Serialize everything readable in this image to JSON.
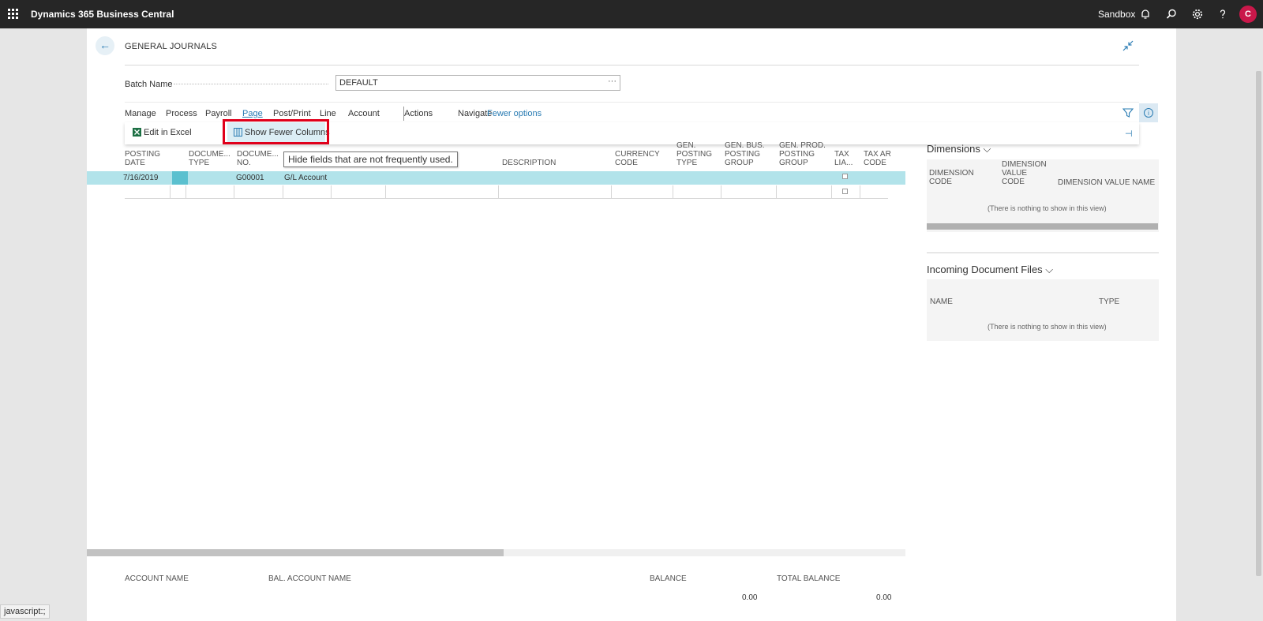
{
  "topbar": {
    "app_title": "Dynamics 365 Business Central",
    "environment": "Sandbox",
    "avatar_initial": "C"
  },
  "page": {
    "title": "GENERAL JOURNALS",
    "back_glyph": "←"
  },
  "batch": {
    "label": "Batch Name",
    "value": "DEFAULT",
    "lookup": "···"
  },
  "actions": {
    "items": [
      "Manage",
      "Process",
      "Payroll",
      "Page",
      "Post/Print",
      "Line",
      "Account",
      "Actions",
      "Navigate",
      "Fewer options"
    ],
    "active": "Page"
  },
  "subactions": {
    "edit_excel": "Edit in Excel",
    "show_fewer": "Show Fewer Columns"
  },
  "tooltip": "Hide fields that are not frequently used.",
  "grid": {
    "columns": [
      [
        "POSTING",
        "DATE"
      ],
      [
        "DOCUME...",
        "TYPE"
      ],
      [
        "DOCUME...",
        "NO."
      ],
      [
        "DESCRIPTION"
      ],
      [
        "CURRENCY",
        "CODE"
      ],
      [
        "GEN.",
        "POSTING",
        "TYPE"
      ],
      [
        "GEN. BUS.",
        "POSTING",
        "GROUP"
      ],
      [
        "GEN. PROD.",
        "POSTING",
        "GROUP"
      ],
      [
        "TAX",
        "LIA..."
      ],
      [
        "TAX AR",
        "CODE"
      ]
    ],
    "row": {
      "posting_date": "7/16/2019",
      "document_no": "G00001",
      "account_type": "G/L Account"
    }
  },
  "footer": {
    "account_name": "ACCOUNT NAME",
    "bal_account_name": "BAL. ACCOUNT NAME",
    "balance": "BALANCE",
    "total_balance": "TOTAL BALANCE",
    "balance_value": "0.00",
    "total_balance_value": "0.00"
  },
  "factbox": {
    "dimensions": {
      "title": "Dimensions",
      "col1": [
        "DIMENSION",
        "CODE"
      ],
      "col2": [
        "DIMENSION",
        "VALUE",
        "CODE"
      ],
      "col3": "DIMENSION VALUE NAME",
      "empty": "(There is nothing to show in this view)"
    },
    "incoming": {
      "title": "Incoming Document Files",
      "col1": "NAME",
      "col2": "TYPE",
      "empty": "(There is nothing to show in this view)"
    }
  },
  "status_bar": "javascript:;"
}
